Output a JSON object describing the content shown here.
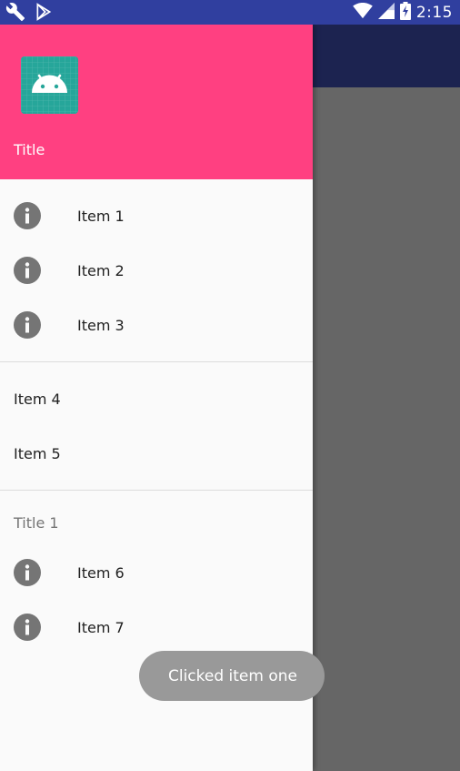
{
  "status_bar": {
    "time": "2:15",
    "left_icons": [
      "wrench-icon",
      "play-store-icon"
    ],
    "right_icons": [
      "wifi-icon",
      "signal-icon",
      "battery-icon"
    ]
  },
  "drawer": {
    "header": {
      "title": "Title",
      "avatar_icon": "android-icon",
      "background_color": "#ff4081"
    },
    "group1": [
      {
        "label": "Item 1",
        "icon": "info-icon"
      },
      {
        "label": "Item 2",
        "icon": "info-icon"
      },
      {
        "label": "Item 3",
        "icon": "info-icon"
      }
    ],
    "group2": [
      {
        "label": "Item 4"
      },
      {
        "label": "Item 5"
      }
    ],
    "group3": {
      "title": "Title 1",
      "items": [
        {
          "label": "Item 6",
          "icon": "info-icon"
        },
        {
          "label": "Item 7",
          "icon": "info-icon"
        }
      ]
    }
  },
  "toast": {
    "message": "Clicked item one"
  },
  "colors": {
    "status_bar": "#303f9f",
    "toolbar": "#1c2350",
    "accent": "#ff4081",
    "icon_gray": "#757575"
  }
}
